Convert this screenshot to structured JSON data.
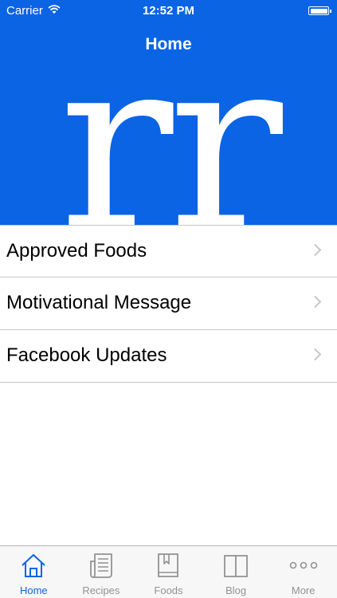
{
  "status_bar": {
    "carrier": "Carrier",
    "time": "12:52 PM"
  },
  "nav": {
    "title": "Home"
  },
  "hero": {
    "logo_text": "rr"
  },
  "menu": {
    "items": [
      {
        "label": "Approved Foods"
      },
      {
        "label": "Motivational Message"
      },
      {
        "label": "Facebook Updates"
      }
    ]
  },
  "tab_bar": {
    "tabs": [
      {
        "label": "Home",
        "icon": "house-icon",
        "active": true
      },
      {
        "label": "Recipes",
        "icon": "newspaper-icon",
        "active": false
      },
      {
        "label": "Foods",
        "icon": "bookmark-book-icon",
        "active": false
      },
      {
        "label": "Blog",
        "icon": "open-book-icon",
        "active": false
      },
      {
        "label": "More",
        "icon": "more-dots-icon",
        "active": false
      }
    ]
  },
  "colors": {
    "brand_blue": "#0a64e4",
    "tab_inactive": "#929292"
  }
}
